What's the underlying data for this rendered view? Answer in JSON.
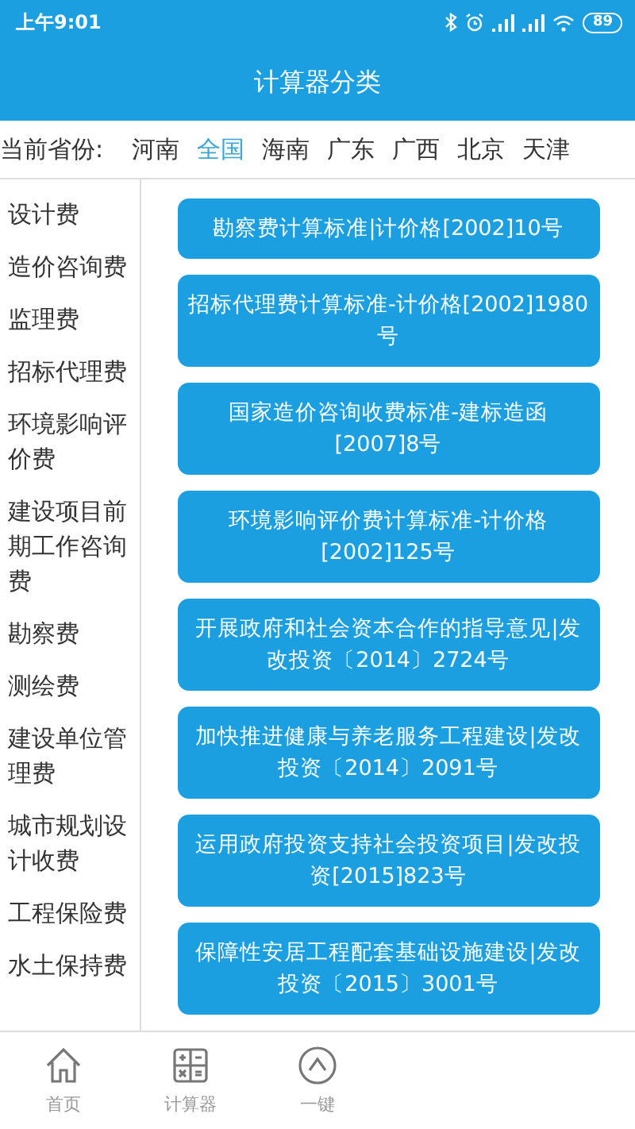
{
  "status_bar": {
    "time": "上午9:01",
    "battery": "89"
  },
  "title": "计算器分类",
  "province": {
    "label": "当前省份:",
    "options": [
      {
        "label": "河南",
        "selected": false
      },
      {
        "label": "全国",
        "selected": true
      },
      {
        "label": "海南",
        "selected": false
      },
      {
        "label": "广东",
        "selected": false
      },
      {
        "label": "广西",
        "selected": false
      },
      {
        "label": "北京",
        "selected": false
      },
      {
        "label": "天津",
        "selected": false
      }
    ]
  },
  "sidebar": {
    "items": [
      {
        "label": "设计费"
      },
      {
        "label": "造价咨询费"
      },
      {
        "label": "监理费"
      },
      {
        "label": "招标代理费"
      },
      {
        "label": "环境影响评价费"
      },
      {
        "label": "建设项目前期工作咨询费"
      },
      {
        "label": "勘察费"
      },
      {
        "label": "测绘费"
      },
      {
        "label": "建设单位管理费"
      },
      {
        "label": "城市规划设计收费"
      },
      {
        "label": "工程保险费"
      },
      {
        "label": "水土保持费"
      }
    ]
  },
  "standards": [
    "勘察费计算标准|计价格[2002]10号",
    "招标代理费计算标准-计价格[2002]1980号",
    "国家造价咨询收费标准-建标造函[2007]8号",
    "环境影响评价费计算标准-计价格[2002]125号",
    "开展政府和社会资本合作的指导意见|发改投资〔2014〕2724号",
    "加快推进健康与养老服务工程建设|发改投资〔2014〕2091号",
    "运用政府投资支持社会投资项目|发改投资[2015]823号",
    "保障性安居工程配套基础设施建设|发改投资〔2015〕3001号"
  ],
  "bottom_nav": [
    {
      "label": "首页",
      "kind": "home"
    },
    {
      "label": "计算器",
      "kind": "calculator"
    },
    {
      "label": "一键",
      "kind": "share"
    }
  ]
}
